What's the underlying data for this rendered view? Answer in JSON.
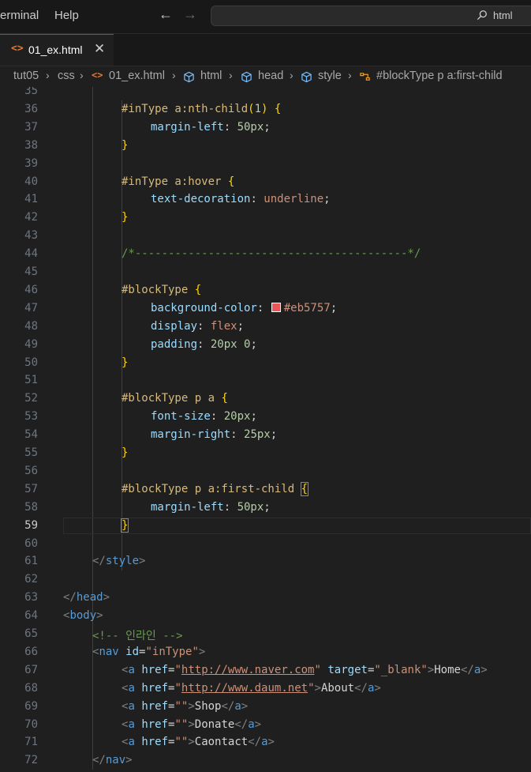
{
  "menu": {
    "terminal": "erminal",
    "help": "Help"
  },
  "command_center": {
    "text": "html"
  },
  "tab": {
    "label": "01_ex.html",
    "icon": "<>",
    "close": "✕"
  },
  "breadcrumb": [
    "tut05",
    "css",
    "01_ex.html",
    "html",
    "head",
    "style",
    "#blockType p a:first-child"
  ],
  "editor": {
    "active_line": 59,
    "lines": [
      {
        "n": "35",
        "segs": []
      },
      {
        "n": "36",
        "segs": [
          [
            "t-sel",
            "#inType a:nth-child"
          ],
          [
            "t-brace",
            "("
          ],
          [
            "t-num",
            "1"
          ],
          [
            "t-brace",
            ")"
          ],
          [
            "t-text",
            " "
          ],
          [
            "t-brace",
            "{"
          ]
        ],
        "indent": 2
      },
      {
        "n": "37",
        "segs": [
          [
            "t-prop",
            "margin-left"
          ],
          [
            "t-text",
            ": "
          ],
          [
            "t-num",
            "50px"
          ],
          [
            "t-text",
            ";"
          ]
        ],
        "indent": 3
      },
      {
        "n": "38",
        "segs": [
          [
            "t-brace",
            "}"
          ]
        ],
        "indent": 2
      },
      {
        "n": "39",
        "segs": []
      },
      {
        "n": "40",
        "segs": [
          [
            "t-sel",
            "#inType a:hover"
          ],
          [
            "t-text",
            " "
          ],
          [
            "t-brace",
            "{"
          ]
        ],
        "indent": 2
      },
      {
        "n": "41",
        "segs": [
          [
            "t-prop",
            "text-decoration"
          ],
          [
            "t-text",
            ": "
          ],
          [
            "t-kw",
            "underline"
          ],
          [
            "t-text",
            ";"
          ]
        ],
        "indent": 3
      },
      {
        "n": "42",
        "segs": [
          [
            "t-brace",
            "}"
          ]
        ],
        "indent": 2
      },
      {
        "n": "43",
        "segs": []
      },
      {
        "n": "44",
        "segs": [
          [
            "t-cmt",
            "/*-----------------------------------------*/"
          ]
        ],
        "indent": 2
      },
      {
        "n": "45",
        "segs": []
      },
      {
        "n": "46",
        "segs": [
          [
            "t-sel",
            "#blockType"
          ],
          [
            "t-text",
            " "
          ],
          [
            "t-brace",
            "{"
          ]
        ],
        "indent": 2
      },
      {
        "n": "47",
        "segs": [
          [
            "t-prop",
            "background-color"
          ],
          [
            "t-text",
            ": "
          ],
          [
            "swatch",
            "#eb5757"
          ],
          [
            "t-kw",
            "#eb5757"
          ],
          [
            "t-text",
            ";"
          ]
        ],
        "indent": 3
      },
      {
        "n": "48",
        "segs": [
          [
            "t-prop",
            "display"
          ],
          [
            "t-text",
            ": "
          ],
          [
            "t-kw",
            "flex"
          ],
          [
            "t-text",
            ";"
          ]
        ],
        "indent": 3
      },
      {
        "n": "49",
        "segs": [
          [
            "t-prop",
            "padding"
          ],
          [
            "t-text",
            ": "
          ],
          [
            "t-num",
            "20px 0"
          ],
          [
            "t-text",
            ";"
          ]
        ],
        "indent": 3
      },
      {
        "n": "50",
        "segs": [
          [
            "t-brace",
            "}"
          ]
        ],
        "indent": 2
      },
      {
        "n": "51",
        "segs": []
      },
      {
        "n": "52",
        "segs": [
          [
            "t-sel",
            "#blockType p a"
          ],
          [
            "t-text",
            " "
          ],
          [
            "t-brace",
            "{"
          ]
        ],
        "indent": 2
      },
      {
        "n": "53",
        "segs": [
          [
            "t-prop",
            "font-size"
          ],
          [
            "t-text",
            ": "
          ],
          [
            "t-num",
            "20px"
          ],
          [
            "t-text",
            ";"
          ]
        ],
        "indent": 3
      },
      {
        "n": "54",
        "segs": [
          [
            "t-prop",
            "margin-right"
          ],
          [
            "t-text",
            ": "
          ],
          [
            "t-num",
            "25px"
          ],
          [
            "t-text",
            ";"
          ]
        ],
        "indent": 3
      },
      {
        "n": "55",
        "segs": [
          [
            "t-brace",
            "}"
          ]
        ],
        "indent": 2
      },
      {
        "n": "56",
        "segs": []
      },
      {
        "n": "57",
        "segs": [
          [
            "t-sel",
            "#blockType p a:first-child"
          ],
          [
            "t-text",
            " "
          ],
          [
            "t-brace brace-match",
            "{"
          ]
        ],
        "indent": 2
      },
      {
        "n": "58",
        "segs": [
          [
            "t-prop",
            "margin-left"
          ],
          [
            "t-text",
            ": "
          ],
          [
            "t-num",
            "50px"
          ],
          [
            "t-text",
            ";"
          ]
        ],
        "indent": 3
      },
      {
        "n": "59",
        "segs": [
          [
            "t-brace brace-match",
            "}"
          ]
        ],
        "indent": 2
      },
      {
        "n": "60",
        "segs": []
      },
      {
        "n": "61",
        "segs": [
          [
            "t-punc",
            "</"
          ],
          [
            "t-tag",
            "style"
          ],
          [
            "t-punc",
            ">"
          ]
        ],
        "indent": 1
      },
      {
        "n": "62",
        "segs": []
      },
      {
        "n": "63",
        "segs": [
          [
            "t-punc",
            "</"
          ],
          [
            "t-tag",
            "head"
          ],
          [
            "t-punc",
            ">"
          ]
        ],
        "indent": 0
      },
      {
        "n": "64",
        "segs": [
          [
            "t-punc",
            "<"
          ],
          [
            "t-tag",
            "body"
          ],
          [
            "t-punc",
            ">"
          ]
        ],
        "indent": 0
      },
      {
        "n": "65",
        "segs": [
          [
            "t-cmt",
            "<!-- 인라인 -->"
          ]
        ],
        "indent": 1
      },
      {
        "n": "66",
        "segs": [
          [
            "t-punc",
            "<"
          ],
          [
            "t-tag",
            "nav"
          ],
          [
            "t-text",
            " "
          ],
          [
            "t-attr",
            "id"
          ],
          [
            "t-text",
            "="
          ],
          [
            "t-str",
            "\"inType\""
          ],
          [
            "t-punc",
            ">"
          ]
        ],
        "indent": 1
      },
      {
        "n": "67",
        "segs": [
          [
            "t-punc",
            "<"
          ],
          [
            "t-tag",
            "a"
          ],
          [
            "t-text",
            " "
          ],
          [
            "t-attr",
            "href"
          ],
          [
            "t-text",
            "="
          ],
          [
            "t-str",
            "\""
          ],
          [
            "t-link",
            "http://www.naver.com"
          ],
          [
            "t-str",
            "\""
          ],
          [
            "t-text",
            " "
          ],
          [
            "t-attr",
            "target"
          ],
          [
            "t-text",
            "="
          ],
          [
            "t-str",
            "\"_blank\""
          ],
          [
            "t-punc",
            ">"
          ],
          [
            "t-text",
            "Home"
          ],
          [
            "t-punc",
            "</"
          ],
          [
            "t-tag",
            "a"
          ],
          [
            "t-punc",
            ">"
          ]
        ],
        "indent": 2
      },
      {
        "n": "68",
        "segs": [
          [
            "t-punc",
            "<"
          ],
          [
            "t-tag",
            "a"
          ],
          [
            "t-text",
            " "
          ],
          [
            "t-attr",
            "href"
          ],
          [
            "t-text",
            "="
          ],
          [
            "t-str",
            "\""
          ],
          [
            "t-link",
            "http://www.daum.net"
          ],
          [
            "t-str",
            "\""
          ],
          [
            "t-punc",
            ">"
          ],
          [
            "t-text",
            "About"
          ],
          [
            "t-punc",
            "</"
          ],
          [
            "t-tag",
            "a"
          ],
          [
            "t-punc",
            ">"
          ]
        ],
        "indent": 2
      },
      {
        "n": "69",
        "segs": [
          [
            "t-punc",
            "<"
          ],
          [
            "t-tag",
            "a"
          ],
          [
            "t-text",
            " "
          ],
          [
            "t-attr",
            "href"
          ],
          [
            "t-text",
            "="
          ],
          [
            "t-str",
            "\"\""
          ],
          [
            "t-punc",
            ">"
          ],
          [
            "t-text",
            "Shop"
          ],
          [
            "t-punc",
            "</"
          ],
          [
            "t-tag",
            "a"
          ],
          [
            "t-punc",
            ">"
          ]
        ],
        "indent": 2
      },
      {
        "n": "70",
        "segs": [
          [
            "t-punc",
            "<"
          ],
          [
            "t-tag",
            "a"
          ],
          [
            "t-text",
            " "
          ],
          [
            "t-attr",
            "href"
          ],
          [
            "t-text",
            "="
          ],
          [
            "t-str",
            "\"\""
          ],
          [
            "t-punc",
            ">"
          ],
          [
            "t-text",
            "Donate"
          ],
          [
            "t-punc",
            "</"
          ],
          [
            "t-tag",
            "a"
          ],
          [
            "t-punc",
            ">"
          ]
        ],
        "indent": 2
      },
      {
        "n": "71",
        "segs": [
          [
            "t-punc",
            "<"
          ],
          [
            "t-tag",
            "a"
          ],
          [
            "t-text",
            " "
          ],
          [
            "t-attr",
            "href"
          ],
          [
            "t-text",
            "="
          ],
          [
            "t-str",
            "\"\""
          ],
          [
            "t-punc",
            ">"
          ],
          [
            "t-text",
            "Caontact"
          ],
          [
            "t-punc",
            "</"
          ],
          [
            "t-tag",
            "a"
          ],
          [
            "t-punc",
            ">"
          ]
        ],
        "indent": 2
      },
      {
        "n": "72",
        "segs": [
          [
            "t-punc",
            "</"
          ],
          [
            "t-tag",
            "nav"
          ],
          [
            "t-punc",
            ">"
          ]
        ],
        "indent": 1
      }
    ]
  }
}
